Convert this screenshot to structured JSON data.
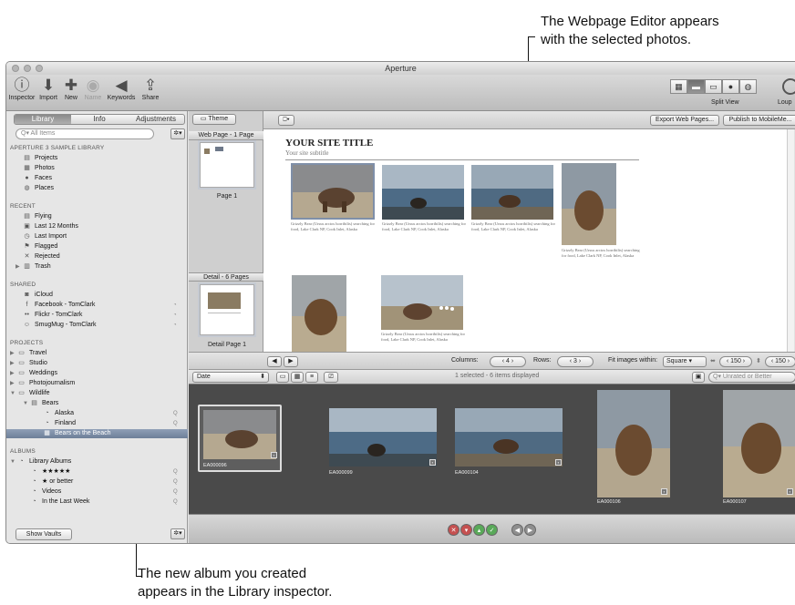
{
  "callouts": {
    "top_line1": "The Webpage Editor appears",
    "top_line2": "with the selected photos.",
    "bottom_line1": "The new album you created",
    "bottom_line2": "appears in the Library inspector."
  },
  "window": {
    "title": "Aperture"
  },
  "toolbar": {
    "buttons": [
      {
        "label": "Inspector",
        "icon": "info-icon",
        "glyph": "ⓘ",
        "enabled": true
      },
      {
        "label": "Import",
        "icon": "import-arrow-icon",
        "glyph": "⬇",
        "enabled": true
      },
      {
        "label": "New",
        "icon": "plus-icon",
        "glyph": "✚",
        "enabled": true
      },
      {
        "label": "Name",
        "icon": "person-icon",
        "glyph": "👤",
        "enabled": false
      },
      {
        "label": "Keywords",
        "icon": "tag-icon",
        "glyph": "◀",
        "enabled": true
      },
      {
        "label": "Share",
        "icon": "share-icon",
        "glyph": "⇪",
        "enabled": true
      }
    ],
    "split_view_label": "Split View",
    "loupe_label": "Loup"
  },
  "sidebar": {
    "tabs": [
      "Library",
      "Info",
      "Adjustments"
    ],
    "active_tab": "Library",
    "search_placeholder": "All Items",
    "sections": {
      "library": "APERTURE 3 SAMPLE LIBRARY",
      "recent": "RECENT",
      "shared": "SHARED",
      "projects": "PROJECTS",
      "albums": "ALBUMS"
    },
    "library_items": [
      {
        "label": "Projects",
        "icon": "projects-icon",
        "glyph": "▤"
      },
      {
        "label": "Photos",
        "icon": "photos-icon",
        "glyph": "▦"
      },
      {
        "label": "Faces",
        "icon": "faces-icon",
        "glyph": "●"
      },
      {
        "label": "Places",
        "icon": "places-icon",
        "glyph": "◍"
      }
    ],
    "recent_items": [
      {
        "label": "Flying",
        "icon": "project-icon",
        "glyph": "▤"
      },
      {
        "label": "Last 12 Months",
        "icon": "calendar-icon",
        "glyph": "▣"
      },
      {
        "label": "Last Import",
        "icon": "clock-icon",
        "glyph": "◷"
      },
      {
        "label": "Flagged",
        "icon": "flag-icon",
        "glyph": "⚑"
      },
      {
        "label": "Rejected",
        "icon": "x-icon",
        "glyph": "✕"
      },
      {
        "label": "Trash",
        "icon": "trash-icon",
        "glyph": "🗑"
      }
    ],
    "shared_items": [
      {
        "label": "iCloud",
        "icon": "icloud-icon",
        "glyph": "◙"
      },
      {
        "label": "Facebook - TomClark",
        "icon": "facebook-icon",
        "glyph": "f"
      },
      {
        "label": "Flickr - TomClark",
        "icon": "flickr-icon",
        "glyph": "••"
      },
      {
        "label": "SmugMug - TomClark",
        "icon": "smugmug-icon",
        "glyph": "☺"
      }
    ],
    "project_items": [
      {
        "label": "Travel",
        "icon": "folder-icon",
        "glyph": "▭"
      },
      {
        "label": "Studio",
        "icon": "folder-icon",
        "glyph": "▭"
      },
      {
        "label": "Weddings",
        "icon": "folder-icon",
        "glyph": "▭"
      },
      {
        "label": "Photojournalism",
        "icon": "folder-icon",
        "glyph": "▭"
      },
      {
        "label": "Wildlife",
        "icon": "folder-icon",
        "glyph": "▭"
      },
      {
        "label": "Bears",
        "icon": "project-icon",
        "glyph": "▤"
      },
      {
        "label": "Alaska",
        "icon": "album-icon",
        "glyph": "◔"
      },
      {
        "label": "Finland",
        "icon": "album-icon",
        "glyph": "◔"
      },
      {
        "label": "Bears on the Beach",
        "icon": "webpage-album-icon",
        "glyph": "▦"
      }
    ],
    "album_items": [
      {
        "label": "Library Albums",
        "icon": "smart-album-icon",
        "glyph": "◔"
      },
      {
        "label": "★★★★★",
        "icon": "smart-album-icon",
        "glyph": "◔"
      },
      {
        "label": "★ or better",
        "icon": "smart-album-icon",
        "glyph": "◔"
      },
      {
        "label": "Videos",
        "icon": "smart-album-icon",
        "glyph": "◔"
      },
      {
        "label": "In the Last Week",
        "icon": "smart-album-icon",
        "glyph": "◔"
      }
    ],
    "show_vaults": "Show Vaults"
  },
  "editor": {
    "theme_button": "Theme",
    "export_button": "Export Web Pages...",
    "publish_button": "Publish to MobileMe...",
    "webpage_header": "Web Page - 1 Page",
    "page_label": "Page 1",
    "detail_header": "Detail - 6 Pages",
    "detail_page_label": "Detail Page 1",
    "site_title": "YOUR SITE TITLE",
    "site_subtitle": "Your site subtitle",
    "caption": "Grizzly Bear (Ursus arctos horribilis) searching for food, Lake Clark NP, Cook Inlet, Alaska",
    "columns_label": "Columns:",
    "columns_value": "4",
    "rows_label": "Rows:",
    "rows_value": "3",
    "fit_label": "Fit images within:",
    "fit_value": "Square",
    "width_value": "150",
    "height_value": "150"
  },
  "browser": {
    "sort_value": "Date",
    "status": "1 selected - 6 items displayed",
    "filter_value": "Unrated or Better",
    "thumbs": [
      {
        "label": "EA000096",
        "selected": true
      },
      {
        "label": "EA000099",
        "selected": false
      },
      {
        "label": "EA000104",
        "selected": false
      },
      {
        "label": "EA000106",
        "selected": false
      },
      {
        "label": "EA000107",
        "selected": false
      }
    ]
  },
  "colors": {
    "selection": "#7687a2",
    "browser_bg": "#4a4a4a",
    "reject": "#c55050",
    "approve": "#59a959"
  }
}
